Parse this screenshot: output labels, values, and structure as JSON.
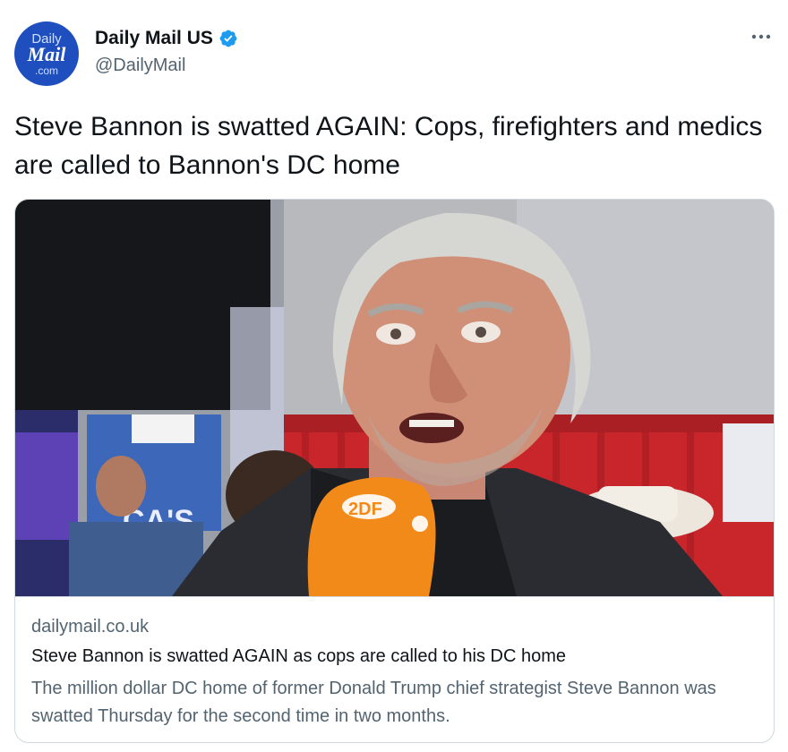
{
  "account": {
    "avatar_logo": {
      "line1": "Daily",
      "line2": "Mail",
      "line3": ".com"
    },
    "name": "Daily Mail US",
    "handle": "@DailyMail",
    "verified": true,
    "more_icon": "more-horizontal-icon"
  },
  "tweet": {
    "text": "Steve Bannon is swatted AGAIN: Cops, firefighters and medics are called to Bannon's DC home"
  },
  "card": {
    "domain": "dailymail.co.uk",
    "title": "Steve Bannon is swatted AGAIN as cops are called to his DC home",
    "description": "The million dollar DC home of former Donald Trump chief strategist Steve Bannon was swatted Thursday for the second time in two months.",
    "image": {
      "microphone_label": "2DF",
      "background_sign_text": "CA'S"
    }
  },
  "colors": {
    "text_primary": "#0f1419",
    "text_secondary": "#536471",
    "border": "#cfd9de",
    "verified_blue": "#1d9bf0",
    "avatar_blue": "#1f4fbf",
    "mic_orange": "#f28a1a",
    "curtain_red": "#c8262b"
  }
}
